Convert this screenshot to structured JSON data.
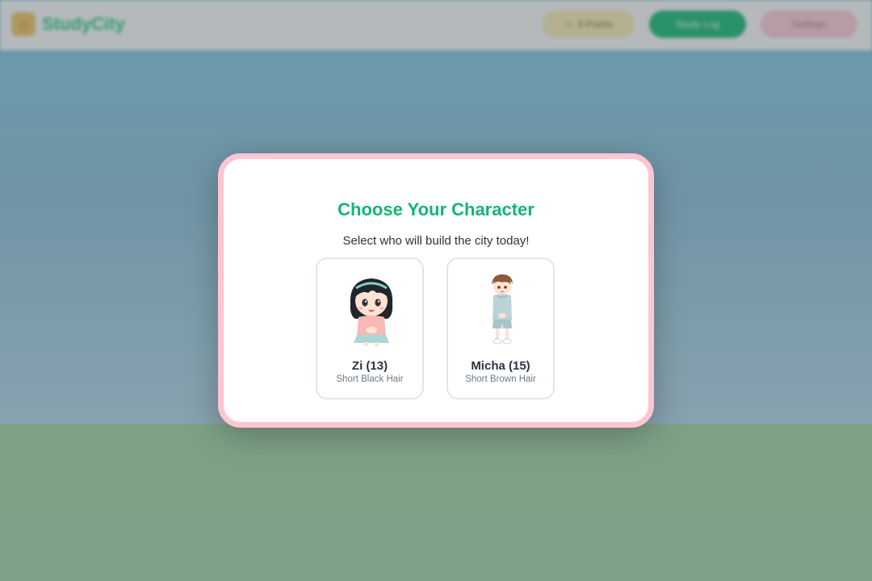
{
  "app": {
    "brand_name": "StudyCity",
    "brand_logo_icon": "house-icon"
  },
  "header": {
    "points_label": "0 Points",
    "points_icon": "star-icon",
    "green_button_label": "Study Log",
    "pink_button_label": "Settings"
  },
  "modal": {
    "title": "Choose Your Character",
    "subtitle": "Select who will build the city today!",
    "characters": [
      {
        "name": "Zi (13)",
        "description": "Short Black Hair"
      },
      {
        "name": "Micha (15)",
        "description": "Short Brown Hair"
      }
    ]
  },
  "colors": {
    "accent_green": "#12b673",
    "modal_border_pink": "#ffc6d2",
    "sky": "#87cfe6",
    "grass": "#a6d9a8"
  }
}
